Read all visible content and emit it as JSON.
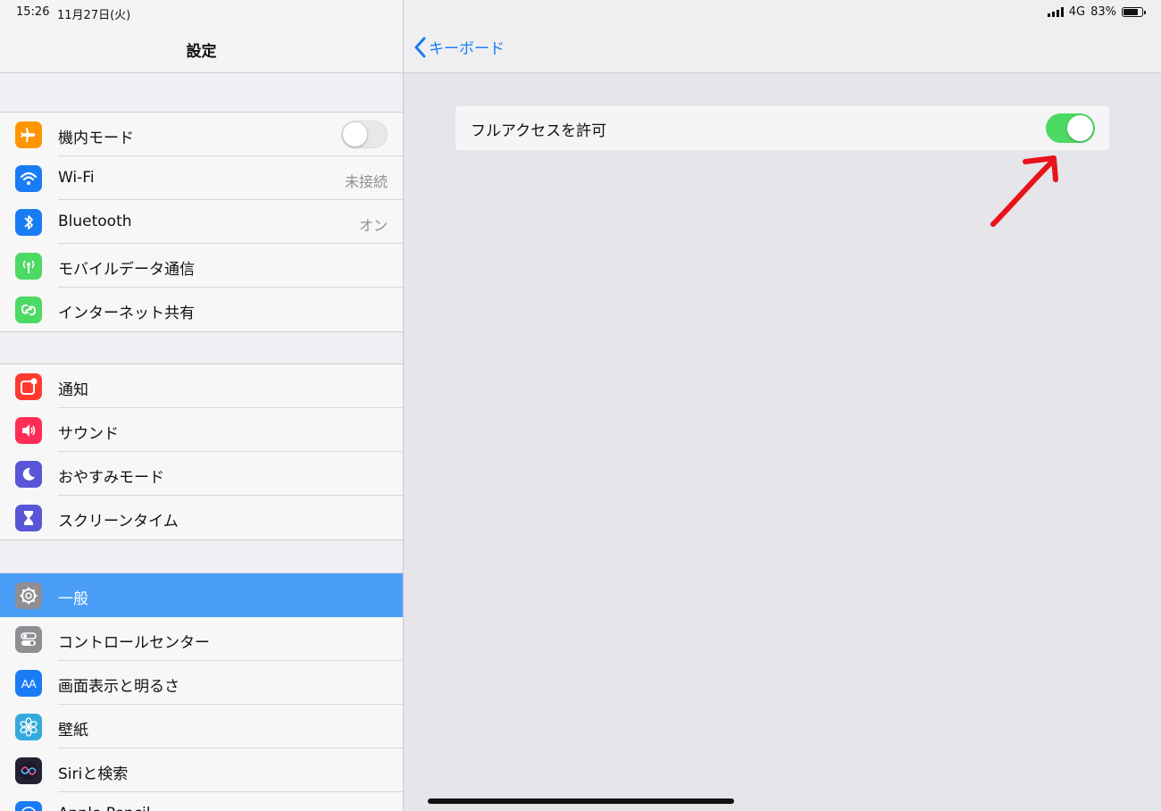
{
  "status": {
    "time": "15:26",
    "date": "11月27日(火)",
    "network": "4G",
    "battery": "83%",
    "battery_level": 0.83
  },
  "master": {
    "title": "設定",
    "groups": [
      [
        {
          "label": "機内モード",
          "icon": "airplane-icon",
          "color": "#ff9500",
          "toggle": false
        },
        {
          "label": "Wi-Fi",
          "value": "未接続",
          "icon": "wifi-icon",
          "color": "#1a7cf5"
        },
        {
          "label": "Bluetooth",
          "value": "オン",
          "icon": "bluetooth-icon",
          "color": "#1a7cf5"
        },
        {
          "label": "モバイルデータ通信",
          "icon": "antenna-icon",
          "color": "#4cd964"
        },
        {
          "label": "インターネット共有",
          "icon": "hotspot-icon",
          "color": "#4cd964"
        }
      ],
      [
        {
          "label": "通知",
          "icon": "notifications-icon",
          "color": "#ff3b30"
        },
        {
          "label": "サウンド",
          "icon": "speaker-icon",
          "color": "#ff2d55"
        },
        {
          "label": "おやすみモード",
          "icon": "moon-icon",
          "color": "#5856d6"
        },
        {
          "label": "スクリーンタイム",
          "icon": "hourglass-icon",
          "color": "#5856d6"
        }
      ],
      [
        {
          "label": "一般",
          "icon": "gear-icon",
          "color": "#8e8e93",
          "selected": true
        },
        {
          "label": "コントロールセンター",
          "icon": "switches-icon",
          "color": "#8e8e93"
        },
        {
          "label": "画面表示と明るさ",
          "icon": "text-size-icon",
          "color": "#1a7cf5",
          "glyph": "AA"
        },
        {
          "label": "壁紙",
          "icon": "flower-icon",
          "color": "#34aadc"
        },
        {
          "label": "Siriと検索",
          "icon": "siri-icon",
          "color": "#222233"
        },
        {
          "label": "Apple Pencil",
          "icon": "pencil-icon",
          "color": "#1a7cf5"
        }
      ]
    ]
  },
  "detail": {
    "back_label": "キーボード",
    "setting_label": "フルアクセスを許可",
    "setting_on": true
  },
  "annotation": {
    "arrow_color": "#e8121a"
  }
}
